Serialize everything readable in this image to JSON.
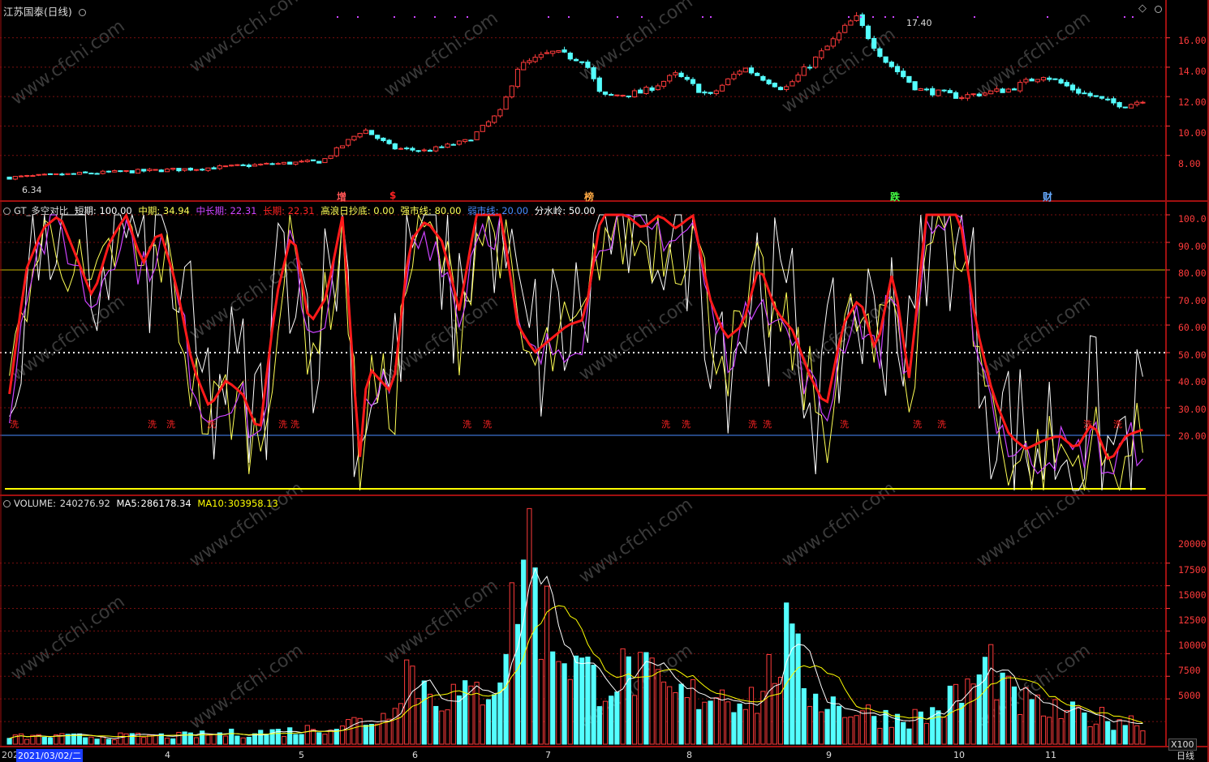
{
  "window": {
    "title": "江苏国泰(日线)",
    "bottom_right_label": "日线",
    "volume_unit_label": "X100",
    "selected_date": "2021/03/02/二",
    "left_date_stub": "202"
  },
  "colors": {
    "background": "#000000",
    "up_candle": "#ff3b3b",
    "down_candle": "#54ffff",
    "grid_red": "#7a1010",
    "axis_red": "#a01010",
    "short_line": "#ffffff",
    "mid_line": "#ffff55",
    "midlong_line": "#cc44ff",
    "long_line": "#ff1a1a",
    "strong_line": "#c8b400",
    "weak_line": "#4a8cff",
    "threshold_line": "#ffffff",
    "ma5": "#ffffff",
    "ma10": "#ffff00"
  },
  "price_panel": {
    "y_ticks": [
      "16.00",
      "14.00",
      "12.00",
      "10.00",
      "8.00"
    ],
    "high_label": "17.40",
    "low_label": "6.34",
    "markers": [
      {
        "text": "增",
        "color": "#ff5555"
      },
      {
        "text": "$",
        "color": "#ff2222"
      },
      {
        "text": "榜",
        "color": "#ffaa44"
      },
      {
        "text": "跌",
        "color": "#44ff44"
      },
      {
        "text": "财",
        "color": "#66aaff"
      }
    ]
  },
  "indicator_panel": {
    "name": "GT_多空对比",
    "params": [
      {
        "label": "短期:",
        "value": "100.00",
        "color": "#ffffff"
      },
      {
        "label": "中期:",
        "value": "34.94",
        "color": "#ffff55"
      },
      {
        "label": "中长期:",
        "value": "22.31",
        "color": "#cc44ff"
      },
      {
        "label": "长期:",
        "value": "22.31",
        "color": "#ff2222"
      },
      {
        "label": "高浪日抄底:",
        "value": "0.00",
        "color": "#ffff55"
      },
      {
        "label": "强市线:",
        "value": "80.00",
        "color": "#ffff55"
      },
      {
        "label": "弱市线:",
        "value": "20.00",
        "color": "#4a8cff"
      },
      {
        "label": "分水岭:",
        "value": "50.00",
        "color": "#ffffff"
      }
    ],
    "y_ticks": [
      "100.0",
      "90.00",
      "80.00",
      "70.00",
      "60.00",
      "50.00",
      "40.00",
      "30.00",
      "20.00"
    ],
    "wash_label": "洗"
  },
  "volume_panel": {
    "name": "VOLUME:",
    "volume": "240276.92",
    "ma5_label": "MA5:",
    "ma5": "286178.34",
    "ma10_label": "MA10:",
    "ma10": "303958.13",
    "y_ticks": [
      "20000",
      "17500",
      "15000",
      "12500",
      "10000",
      "7500",
      "5000"
    ]
  },
  "x_axis": {
    "months": [
      "4",
      "5",
      "6",
      "7",
      "8",
      "9",
      "10",
      "11"
    ]
  },
  "watermark": "www.cfchi.com",
  "chart_data": {
    "type": "candlestick",
    "title": "江苏国泰(日线)",
    "n_bars": 195,
    "price_range": [
      6.34,
      17.4
    ],
    "close_keypoints": [
      [
        0,
        6.5
      ],
      [
        20,
        6.8
      ],
      [
        45,
        7.1
      ],
      [
        62,
        7.4
      ],
      [
        75,
        7.6
      ],
      [
        85,
        9.8
      ],
      [
        92,
        8.5
      ],
      [
        100,
        8.3
      ],
      [
        110,
        9.0
      ],
      [
        118,
        11.0
      ],
      [
        122,
        14.0
      ],
      [
        130,
        15.0
      ],
      [
        138,
        14.5
      ],
      [
        142,
        12.0
      ],
      [
        152,
        12.3
      ],
      [
        160,
        13.5
      ],
      [
        168,
        12.0
      ],
      [
        176,
        14.0
      ],
      [
        186,
        12.5
      ],
      [
        195,
        15.0
      ],
      [
        203,
        17.4
      ],
      [
        210,
        14.5
      ],
      [
        218,
        12.5
      ],
      [
        228,
        12.0
      ],
      [
        240,
        12.5
      ],
      [
        248,
        13.5
      ],
      [
        256,
        12.4
      ],
      [
        264,
        11.6
      ],
      [
        268,
        11.4
      ],
      [
        272,
        11.8
      ]
    ],
    "indicator_ylim": [
      0,
      100
    ],
    "reference_lines": {
      "strong": 80,
      "weak": 20,
      "watershed": 50
    },
    "long_keypoints": [
      [
        0,
        35
      ],
      [
        4,
        80
      ],
      [
        8,
        95
      ],
      [
        12,
        100
      ],
      [
        16,
        85
      ],
      [
        20,
        70
      ],
      [
        24,
        90
      ],
      [
        28,
        100
      ],
      [
        32,
        82
      ],
      [
        36,
        95
      ],
      [
        40,
        75
      ],
      [
        44,
        45
      ],
      [
        48,
        30
      ],
      [
        52,
        40
      ],
      [
        56,
        35
      ],
      [
        60,
        20
      ],
      [
        64,
        70
      ],
      [
        68,
        95
      ],
      [
        72,
        60
      ],
      [
        76,
        70
      ],
      [
        80,
        100
      ],
      [
        84,
        10
      ],
      [
        86,
        45
      ],
      [
        92,
        35
      ],
      [
        96,
        90
      ],
      [
        100,
        98
      ],
      [
        104,
        90
      ],
      [
        108,
        65
      ],
      [
        112,
        100
      ],
      [
        118,
        100
      ],
      [
        122,
        60
      ],
      [
        126,
        50
      ],
      [
        130,
        55
      ],
      [
        134,
        60
      ],
      [
        138,
        62
      ],
      [
        142,
        100
      ],
      [
        148,
        100
      ],
      [
        152,
        95
      ],
      [
        156,
        100
      ],
      [
        160,
        95
      ],
      [
        164,
        100
      ],
      [
        168,
        70
      ],
      [
        172,
        55
      ],
      [
        176,
        60
      ],
      [
        180,
        82
      ],
      [
        184,
        65
      ],
      [
        188,
        58
      ],
      [
        192,
        42
      ],
      [
        196,
        30
      ],
      [
        200,
        60
      ],
      [
        204,
        70
      ],
      [
        208,
        50
      ],
      [
        212,
        80
      ],
      [
        216,
        40
      ],
      [
        220,
        100
      ],
      [
        228,
        100
      ],
      [
        232,
        60
      ],
      [
        236,
        35
      ],
      [
        240,
        20
      ],
      [
        244,
        15
      ],
      [
        248,
        18
      ],
      [
        252,
        20
      ],
      [
        256,
        15
      ],
      [
        260,
        25
      ],
      [
        264,
        10
      ],
      [
        268,
        20
      ],
      [
        272,
        22
      ]
    ],
    "volume_ylim": [
      0,
      24000
    ],
    "volume_keypoints": [
      [
        0,
        800
      ],
      [
        40,
        900
      ],
      [
        70,
        1500
      ],
      [
        90,
        3000
      ],
      [
        95,
        9000
      ],
      [
        100,
        6000
      ],
      [
        110,
        5000
      ],
      [
        116,
        7000
      ],
      [
        120,
        12000
      ],
      [
        124,
        24000
      ],
      [
        128,
        14000
      ],
      [
        134,
        10000
      ],
      [
        140,
        7000
      ],
      [
        150,
        8000
      ],
      [
        160,
        5000
      ],
      [
        170,
        6000
      ],
      [
        180,
        5000
      ],
      [
        186,
        11500
      ],
      [
        192,
        6000
      ],
      [
        200,
        4000
      ],
      [
        210,
        3000
      ],
      [
        220,
        3000
      ],
      [
        230,
        6000
      ],
      [
        236,
        9000
      ],
      [
        240,
        5000
      ],
      [
        250,
        3500
      ],
      [
        260,
        3000
      ],
      [
        272,
        2500
      ]
    ]
  }
}
